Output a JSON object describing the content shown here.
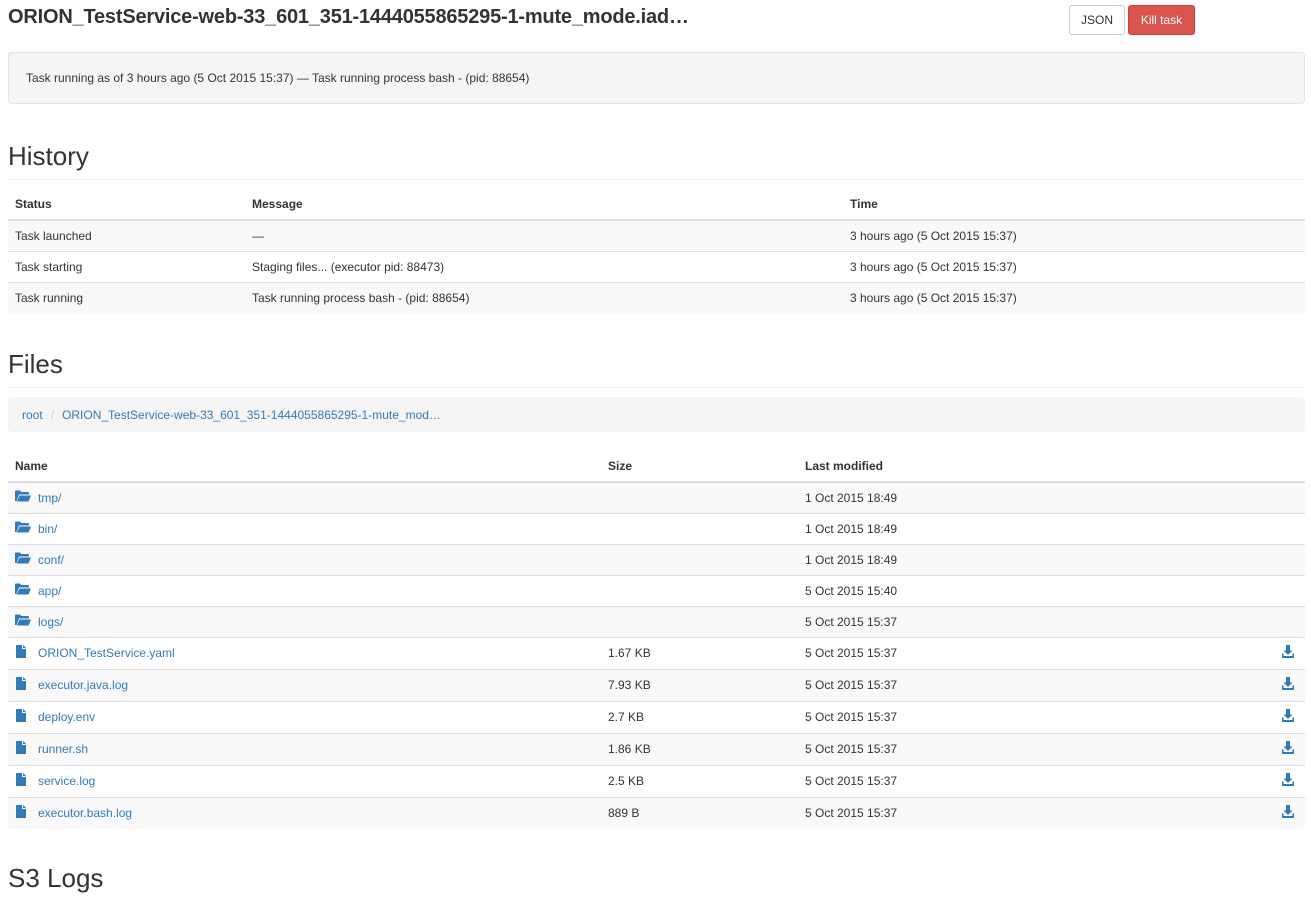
{
  "header": {
    "title": "ORION_TestService-web-33_601_351-1444055865295-1-mute_mode.iad…",
    "json_label": "JSON",
    "kill_label": "Kill task"
  },
  "status_bar": {
    "text": "Task running as of 3 hours ago (5 Oct 2015 15:37) — Task running process bash - (pid: 88654)"
  },
  "history": {
    "title": "History",
    "columns": [
      "Status",
      "Message",
      "Time"
    ],
    "rows": [
      {
        "status": "Task launched",
        "message": "—",
        "time": "3 hours ago (5 Oct 2015 15:37)"
      },
      {
        "status": "Task starting",
        "message": "Staging files... (executor pid: 88473)",
        "time": "3 hours ago (5 Oct 2015 15:37)"
      },
      {
        "status": "Task running",
        "message": "Task running process bash - (pid: 88654)",
        "time": "3 hours ago (5 Oct 2015 15:37)"
      }
    ]
  },
  "files": {
    "title": "Files",
    "breadcrumb": [
      "root",
      "ORION_TestService-web-33_601_351-1444055865295-1-mute_mod…"
    ],
    "columns": [
      "Name",
      "Size",
      "Last modified"
    ],
    "rows": [
      {
        "name": "tmp/",
        "size": "",
        "modified": "1 Oct 2015 18:49",
        "icon": "folder-open-icon"
      },
      {
        "name": "bin/",
        "size": "",
        "modified": "1 Oct 2015 18:49",
        "icon": "folder-open-icon"
      },
      {
        "name": "conf/",
        "size": "",
        "modified": "1 Oct 2015 18:49",
        "icon": "folder-open-icon"
      },
      {
        "name": "app/",
        "size": "",
        "modified": "5 Oct 2015 15:40",
        "icon": "folder-open-icon"
      },
      {
        "name": "logs/",
        "size": "",
        "modified": "5 Oct 2015 15:37",
        "icon": "folder-open-icon"
      },
      {
        "name": "ORION_TestService.yaml",
        "size": "1.67 KB",
        "modified": "5 Oct 2015 15:37",
        "icon": "file-icon"
      },
      {
        "name": "executor.java.log",
        "size": "7.93 KB",
        "modified": "5 Oct 2015 15:37",
        "icon": "file-icon"
      },
      {
        "name": "deploy.env",
        "size": "2.7 KB",
        "modified": "5 Oct 2015 15:37",
        "icon": "file-icon"
      },
      {
        "name": "runner.sh",
        "size": "1.86 KB",
        "modified": "5 Oct 2015 15:37",
        "icon": "file-icon"
      },
      {
        "name": "service.log",
        "size": "2.5 KB",
        "modified": "5 Oct 2015 15:37",
        "icon": "file-icon"
      },
      {
        "name": "executor.bash.log",
        "size": "889 B",
        "modified": "5 Oct 2015 15:37",
        "icon": "file-icon"
      }
    ]
  },
  "s3": {
    "title": "S3 Logs"
  },
  "colors": {
    "link": "#337ab7",
    "danger": "#d9534f",
    "well": "#f5f5f5"
  }
}
